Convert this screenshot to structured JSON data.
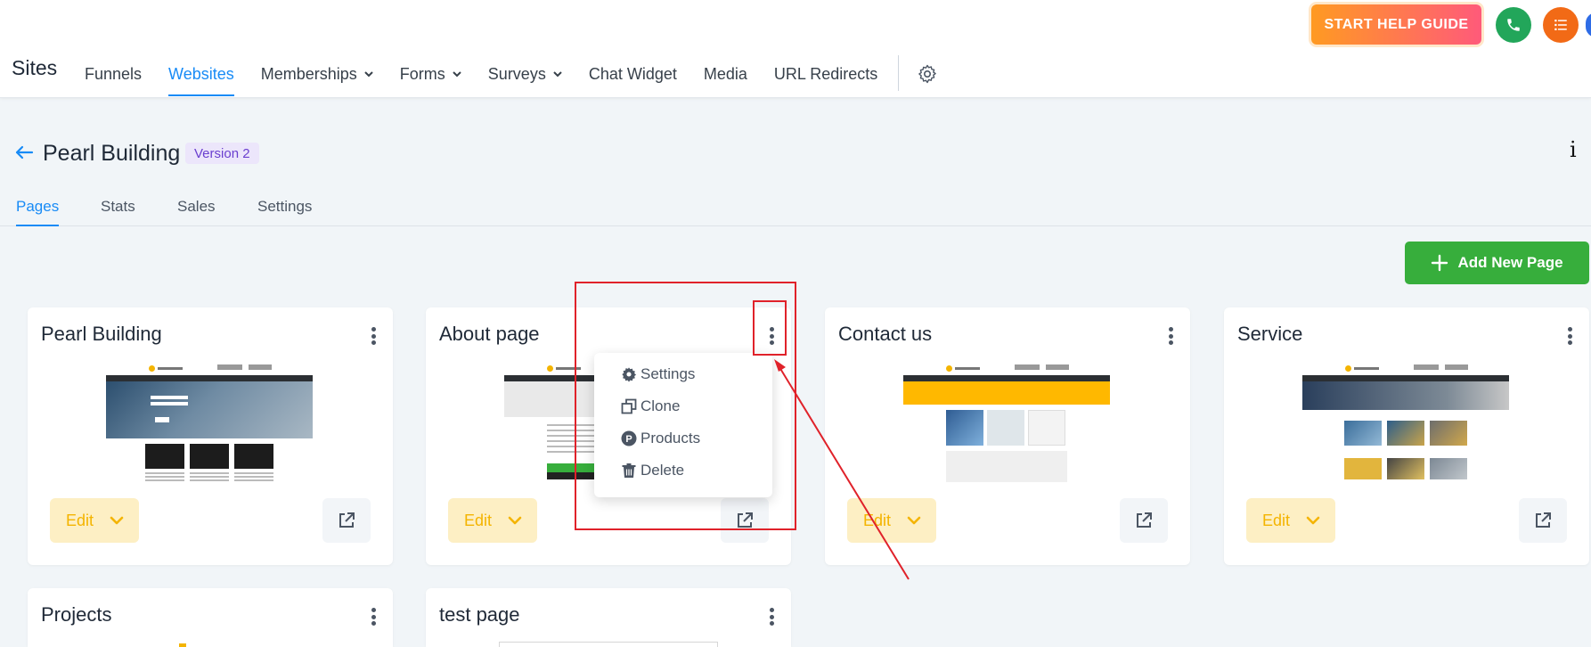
{
  "header": {
    "app_title": "Sites",
    "nav": [
      {
        "label": "Funnels",
        "has_dropdown": false,
        "active": false
      },
      {
        "label": "Websites",
        "has_dropdown": false,
        "active": true
      },
      {
        "label": "Memberships",
        "has_dropdown": true,
        "active": false
      },
      {
        "label": "Forms",
        "has_dropdown": true,
        "active": false
      },
      {
        "label": "Surveys",
        "has_dropdown": true,
        "active": false
      },
      {
        "label": "Chat Widget",
        "has_dropdown": false,
        "active": false
      },
      {
        "label": "Media",
        "has_dropdown": false,
        "active": false
      },
      {
        "label": "URL Redirects",
        "has_dropdown": false,
        "active": false
      }
    ],
    "help_button": "START HELP GUIDE",
    "icons": [
      "gear-icon",
      "phone-icon",
      "list-icon"
    ]
  },
  "site": {
    "name": "Pearl Building",
    "version_badge": "Version 2",
    "info_label": "i"
  },
  "subtabs": [
    {
      "label": "Pages",
      "active": true
    },
    {
      "label": "Stats",
      "active": false
    },
    {
      "label": "Sales",
      "active": false
    },
    {
      "label": "Settings",
      "active": false
    }
  ],
  "add_page_label": "Add New Page",
  "cards": [
    {
      "title": "Pearl Building",
      "thumb": "hero"
    },
    {
      "title": "About page",
      "thumb": "about"
    },
    {
      "title": "Contact us",
      "thumb": "contact"
    },
    {
      "title": "Service",
      "thumb": "service"
    },
    {
      "title": "Projects",
      "thumb": "partial"
    },
    {
      "title": "test page",
      "thumb": "partial"
    }
  ],
  "edit_label": "Edit",
  "page_menu": {
    "items": [
      {
        "label": "Settings",
        "icon": "gear-icon"
      },
      {
        "label": "Clone",
        "icon": "clone-icon"
      },
      {
        "label": "Products",
        "icon": "products-icon"
      },
      {
        "label": "Delete",
        "icon": "trash-icon"
      }
    ]
  },
  "colors": {
    "accent": "#188bf6",
    "add_button": "#37ae3c",
    "edit_bg": "#fdefc4",
    "edit_text": "#f4b400",
    "annotation": "#e0222a"
  }
}
